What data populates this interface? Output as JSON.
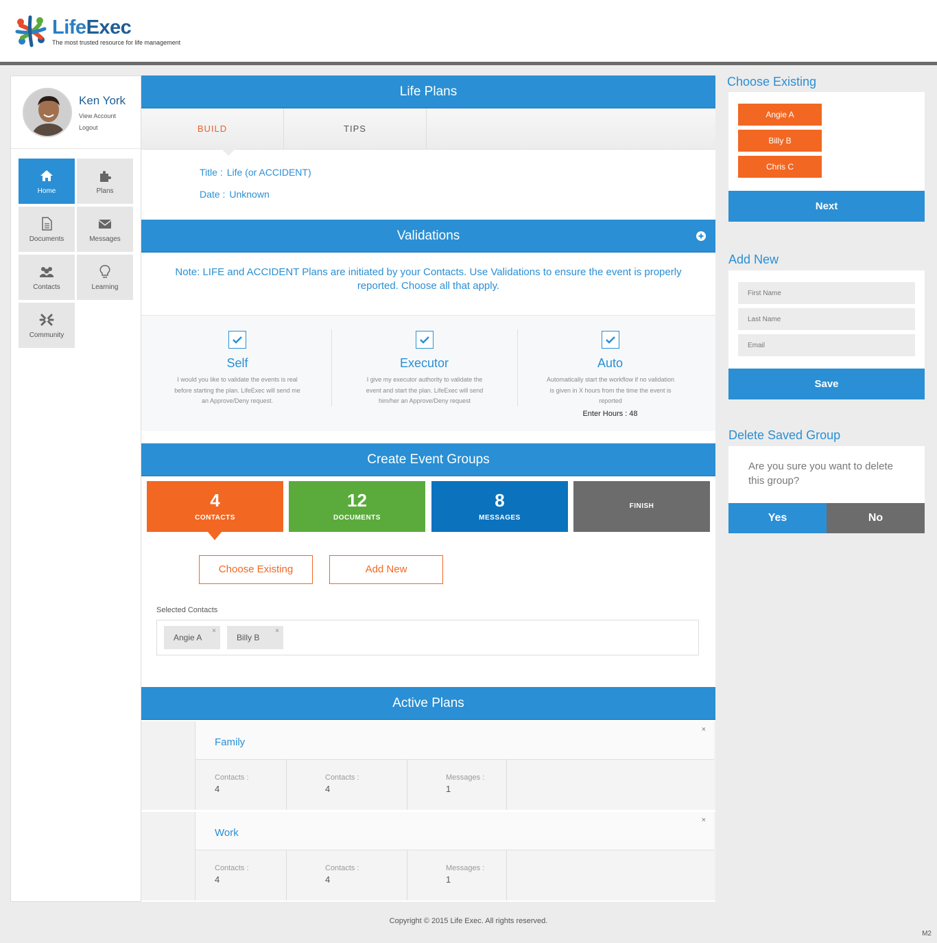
{
  "brand": {
    "name_part1": "Life",
    "name_part2": "Exec",
    "tagline": "The most trusted resource for life management"
  },
  "user": {
    "name": "Ken York",
    "view_account": "View Account",
    "logout": "Logout"
  },
  "nav": [
    {
      "label": "Home",
      "icon": "home-icon"
    },
    {
      "label": "Plans",
      "icon": "puzzle-icon"
    },
    {
      "label": "Documents",
      "icon": "document-icon"
    },
    {
      "label": "Messages",
      "icon": "envelope-icon"
    },
    {
      "label": "Contacts",
      "icon": "users-icon"
    },
    {
      "label": "Learning",
      "icon": "lightbulb-icon"
    },
    {
      "label": "Community",
      "icon": "community-icon"
    }
  ],
  "life_plans": {
    "title": "Life Plans",
    "tabs": [
      "BUILD",
      "TIPS"
    ],
    "title_label": "Title :",
    "title_value": "Life (or ACCIDENT)",
    "date_label": "Date :",
    "date_value": "Unknown"
  },
  "validations": {
    "title": "Validations",
    "note": "Note: LIFE and ACCIDENT Plans are initiated by your Contacts. Use Validations to ensure the event is properly reported. Choose all that apply.",
    "options": [
      {
        "title": "Self",
        "desc": "I would you like to validate the events is real before starting the plan. LifeExec will send me an Approve/Deny request.",
        "checked": true
      },
      {
        "title": "Executor",
        "desc": "I give my executor authority to validate the event and start the plan. LifeExec will send him/her an Approve/Deny request",
        "checked": true
      },
      {
        "title": "Auto",
        "desc": "Automatically start the workflow if no validation is given in X hours from the time the event is reported",
        "extra": "Enter Hours : 48",
        "checked": true
      }
    ]
  },
  "event_groups": {
    "title": "Create Event Groups",
    "stats": [
      {
        "number": "4",
        "label": "CONTACTS",
        "color": "#f26722"
      },
      {
        "number": "12",
        "label": "DOCUMENTS",
        "color": "#5aab3c"
      },
      {
        "number": "8",
        "label": "MESSAGES",
        "color": "#0b72bd"
      },
      {
        "number": "",
        "label": "FINISH",
        "color": "#6c6c6c"
      }
    ],
    "choose_existing": "Choose Existing",
    "add_new": "Add New",
    "selected_label": "Selected Contacts",
    "selected": [
      "Angie A",
      "Billy B"
    ],
    "remove_glyph": "×"
  },
  "active_plans": {
    "title": "Active Plans",
    "close_glyph": "×",
    "plans": [
      {
        "name": "Family",
        "cells": [
          {
            "label": "Contacts :",
            "value": "4"
          },
          {
            "label": "Contacts :",
            "value": "4"
          },
          {
            "label": "Messages :",
            "value": "1"
          }
        ]
      },
      {
        "name": "Work",
        "cells": [
          {
            "label": "Contacts :",
            "value": "4"
          },
          {
            "label": "Contacts :",
            "value": "4"
          },
          {
            "label": "Messages :",
            "value": "1"
          }
        ]
      }
    ]
  },
  "right": {
    "choose_existing": {
      "title": "Choose Existing",
      "contacts": [
        "Angie A",
        "Billy B",
        "Chris C"
      ],
      "next": "Next"
    },
    "add_new": {
      "title": "Add New",
      "first_name_placeholder": "First Name",
      "last_name_placeholder": "Last Name",
      "email_placeholder": "Email",
      "save": "Save"
    },
    "delete_group": {
      "title": "Delete Saved Group",
      "question": "Are you sure you want to delete this group?",
      "yes": "Yes",
      "no": "No"
    }
  },
  "footer": {
    "copyright": "Copyright  ©  2015  Life Exec.   All rights reserved.",
    "version": "M2"
  },
  "colors": {
    "primary": "#2a8fd4",
    "orange": "#f26722",
    "green": "#5aab3c",
    "dark_blue": "#0b72bd",
    "gray": "#6c6c6c"
  }
}
